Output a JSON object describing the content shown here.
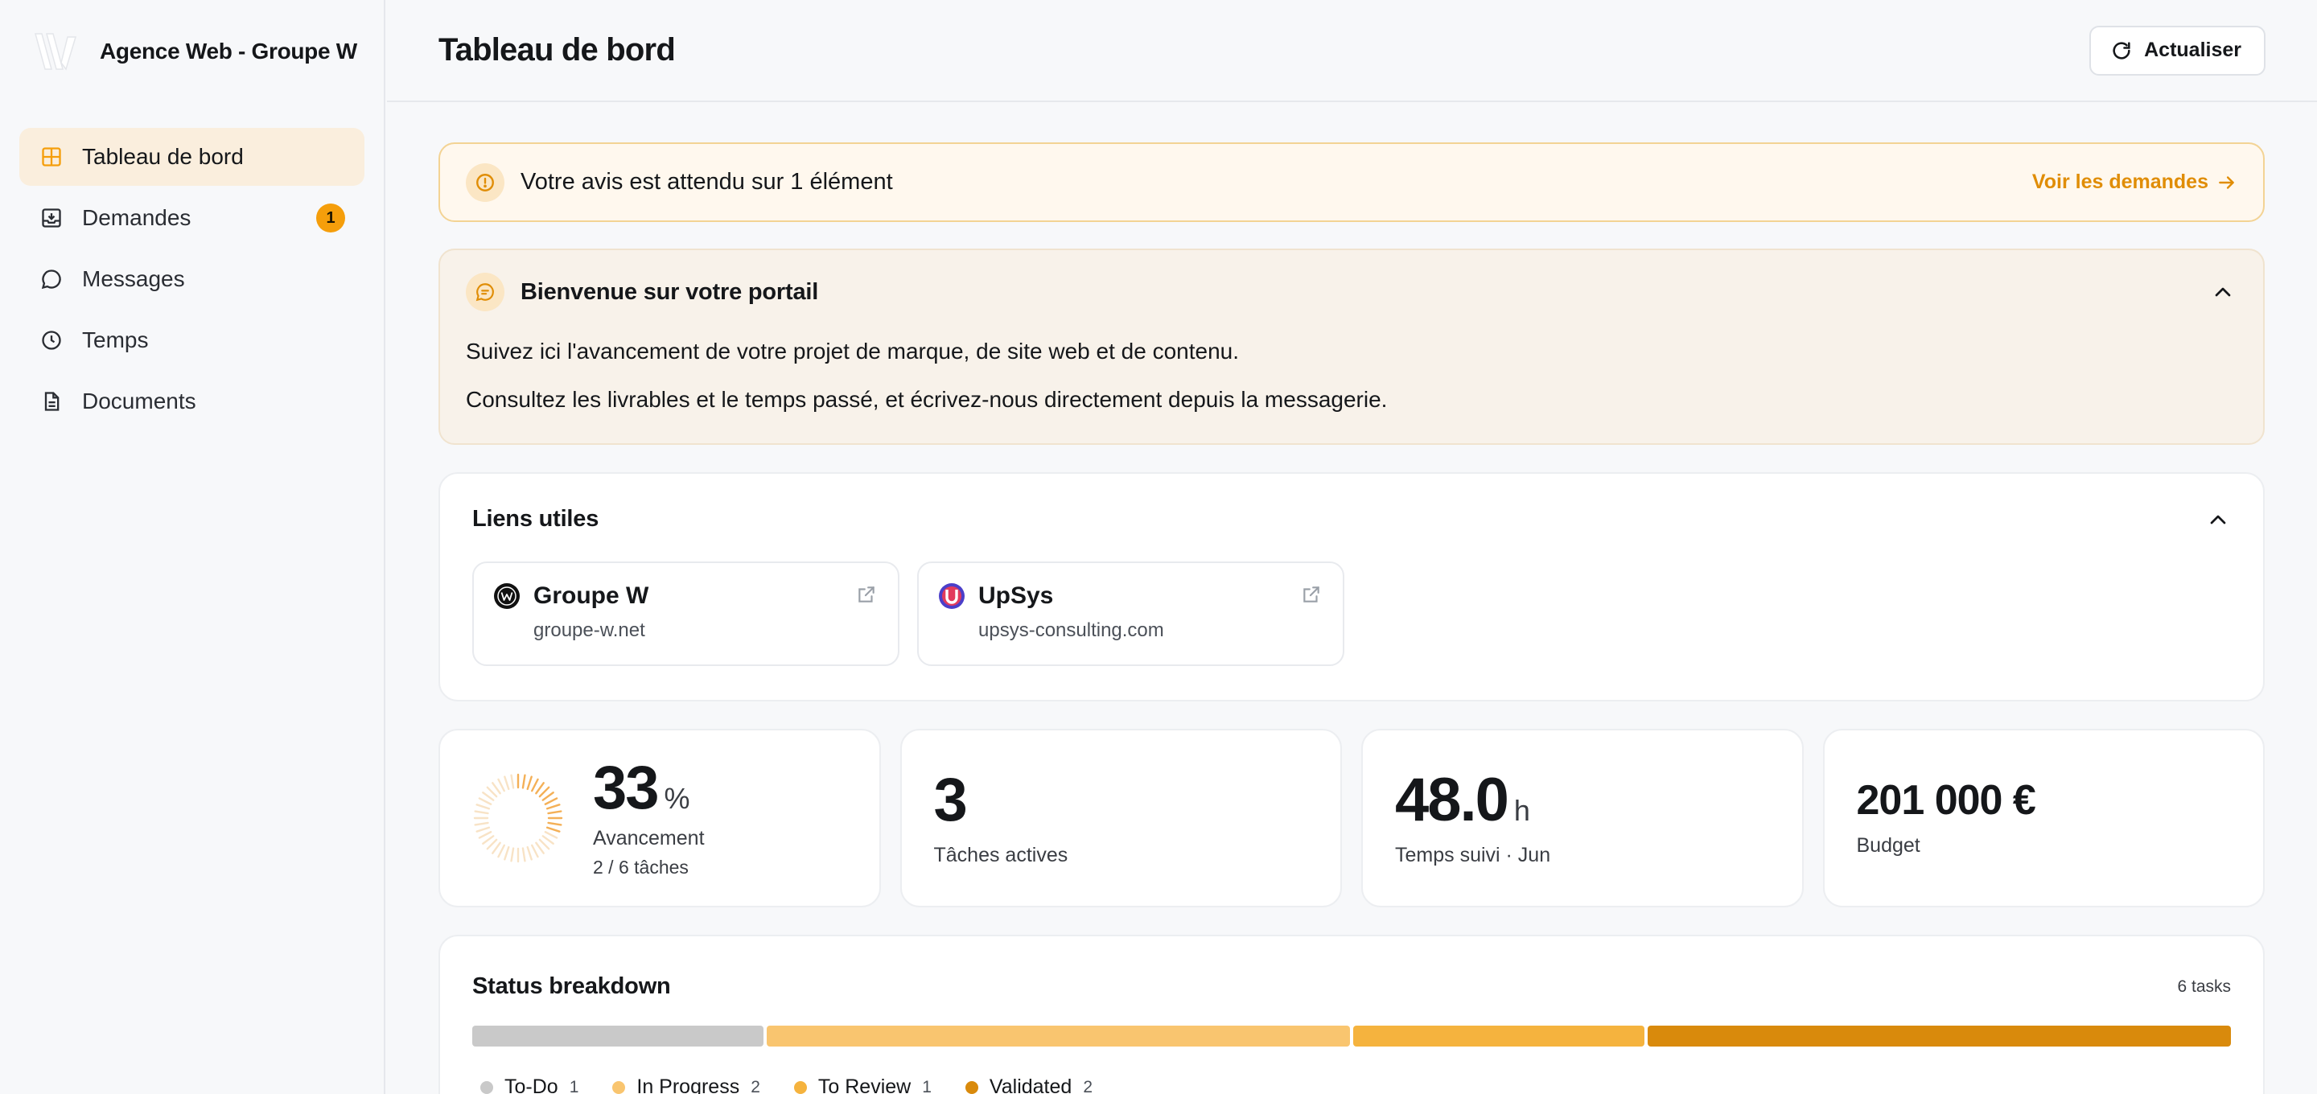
{
  "brand": {
    "name": "Agence Web - Groupe W"
  },
  "nav": [
    {
      "label": "Tableau de bord",
      "icon": "dashboard-grid-icon",
      "active": true
    },
    {
      "label": "Demandes",
      "icon": "inbox-download-icon",
      "badge": "1"
    },
    {
      "label": "Messages",
      "icon": "chat-bubble-icon"
    },
    {
      "label": "Temps",
      "icon": "clock-icon"
    },
    {
      "label": "Documents",
      "icon": "document-icon"
    }
  ],
  "header": {
    "title": "Tableau de bord",
    "refresh_label": "Actualiser"
  },
  "alert": {
    "text": "Votre avis est attendu sur 1 élément",
    "link_label": "Voir les demandes"
  },
  "welcome": {
    "title": "Bienvenue sur votre portail",
    "lines": [
      "Suivez ici l'avancement de votre projet de marque, de site web et de contenu.",
      "Consultez les livrables et le temps passé, et écrivez-nous directement depuis la messagerie."
    ]
  },
  "links": {
    "title": "Liens utiles",
    "items": [
      {
        "name": "Groupe W",
        "url": "groupe-w.net",
        "icon": "groupe-w-favicon"
      },
      {
        "name": "UpSys",
        "url": "upsys-consulting.com",
        "icon": "upsys-favicon"
      }
    ]
  },
  "stats": {
    "progress": {
      "value": "33",
      "unit": "%",
      "label": "Avancement",
      "sub": "2 / 6 tâches",
      "fraction": 0.33
    },
    "tasks": {
      "value": "3",
      "label": "Tâches actives"
    },
    "time": {
      "value": "48.0",
      "unit": "h",
      "label": "Temps suivi · Jun"
    },
    "budget": {
      "value": "201 000 €",
      "label": "Budget"
    }
  },
  "status": {
    "title": "Status breakdown",
    "total_label": "6 tasks",
    "segments": [
      {
        "name": "To-Do",
        "count": 1,
        "color": "#c9c9c9"
      },
      {
        "name": "In Progress",
        "count": 2,
        "color": "#f9c56f"
      },
      {
        "name": "To Review",
        "count": 1,
        "color": "#f5b33e"
      },
      {
        "name": "Validated",
        "count": 2,
        "color": "#d98a0c"
      }
    ]
  },
  "colors": {
    "accent": "#f59e0b",
    "accent_dark": "#e08d06",
    "active_nav_bg": "#faeedd"
  }
}
